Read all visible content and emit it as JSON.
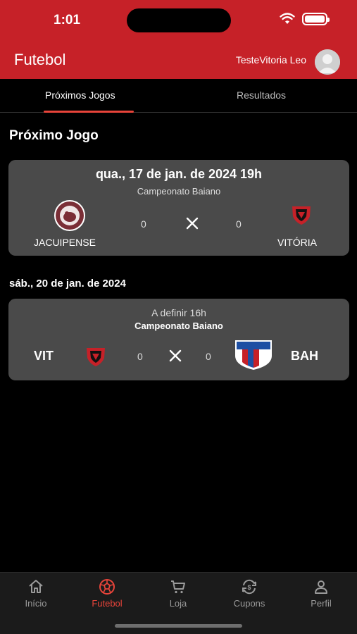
{
  "status_bar": {
    "time": "1:01"
  },
  "header": {
    "title": "Futebol",
    "user_name": "TesteVitoria Leo"
  },
  "tabs": [
    {
      "label": "Próximos Jogos",
      "active": true
    },
    {
      "label": "Resultados",
      "active": false
    }
  ],
  "next_game_section": {
    "title": "Próximo Jogo"
  },
  "match1": {
    "date_time": "qua., 17 de jan. de 2024  19h",
    "competition": "Campeonato Baiano",
    "home_team": "JACUIPENSE",
    "away_team": "VITÓRIA",
    "home_score": "0",
    "away_score": "0"
  },
  "match2": {
    "date_heading": "sáb., 20 de jan. de 2024",
    "time": "A definir  16h",
    "competition": "Campeonato Baiano",
    "home_abbr": "VIT",
    "away_abbr": "BAH",
    "home_score": "0",
    "away_score": "0"
  },
  "bottom_nav": [
    {
      "label": "Início",
      "icon": "home-icon",
      "active": false
    },
    {
      "label": "Futebol",
      "icon": "soccer-ball-icon",
      "active": true
    },
    {
      "label": "Loja",
      "icon": "cart-icon",
      "active": false
    },
    {
      "label": "Cupons",
      "icon": "coupon-exchange-icon",
      "active": false
    },
    {
      "label": "Perfil",
      "icon": "profile-icon",
      "active": false
    }
  ],
  "colors": {
    "primary_red": "#c62128",
    "accent_red": "#e8443a",
    "card_bg": "#4a4a4a",
    "background": "#000000"
  }
}
